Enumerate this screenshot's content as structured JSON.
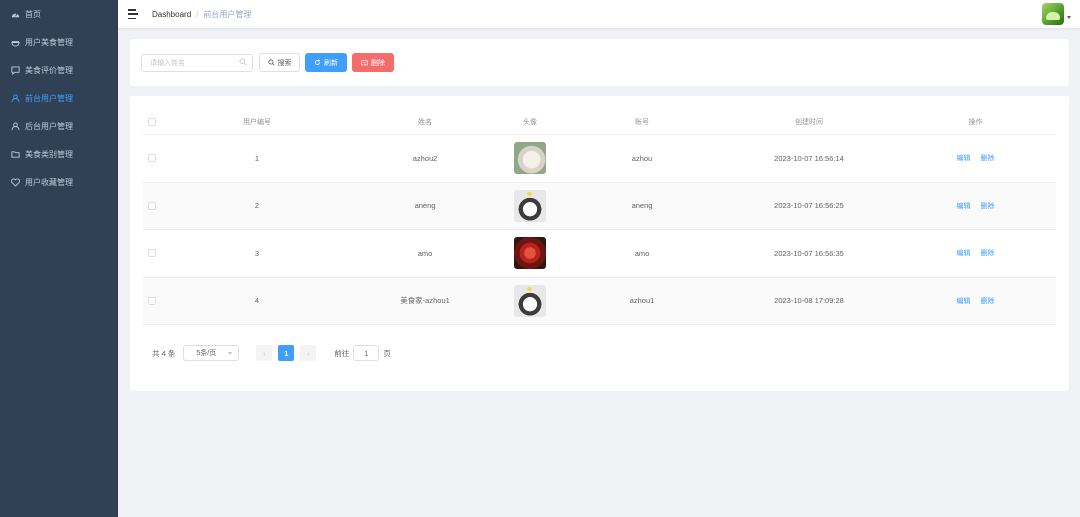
{
  "sidebar": {
    "items": [
      {
        "label": "首页",
        "icon": "dashboard-icon",
        "active": false
      },
      {
        "label": "用户美食管理",
        "icon": "food-icon",
        "active": false
      },
      {
        "label": "美食评价管理",
        "icon": "comment-icon",
        "active": false
      },
      {
        "label": "前台用户管理",
        "icon": "user-icon",
        "active": true
      },
      {
        "label": "后台用户管理",
        "icon": "user-icon",
        "active": false
      },
      {
        "label": "美食类别管理",
        "icon": "folder-icon",
        "active": false
      },
      {
        "label": "用户收藏管理",
        "icon": "heart-icon",
        "active": false
      }
    ]
  },
  "header": {
    "breadcrumb_home": "Dashboard",
    "breadcrumb_sep": "/",
    "breadcrumb_current": "前台用户管理"
  },
  "search": {
    "placeholder": "请输入姓名",
    "value": "",
    "search_label": "搜索",
    "refresh_label": "刷新",
    "delete_label": "删除"
  },
  "table": {
    "columns": [
      "用户编号",
      "姓名",
      "头像",
      "账号",
      "创建时间",
      "操作"
    ],
    "rows": [
      {
        "id": "1",
        "name": "azhou2",
        "avatar": "cat-photo",
        "account": "azhou",
        "created": "2023-10-07 16:56:14"
      },
      {
        "id": "2",
        "name": "aneng",
        "avatar": "husky-photo",
        "account": "aneng",
        "created": "2023-10-07 16:56:25"
      },
      {
        "id": "3",
        "name": "amo",
        "avatar": "flower-photo",
        "account": "amo",
        "created": "2023-10-07 16:56:35"
      },
      {
        "id": "4",
        "name": "美食家-azhou1",
        "avatar": "husky-photo",
        "account": "azhou1",
        "created": "2023-10-08 17:09:28"
      }
    ],
    "edit_label": "编辑",
    "delete_label": "删除"
  },
  "pagination": {
    "total": "共 4 条",
    "page_size": "5条/页",
    "prev": "‹",
    "current_page": "1",
    "next": "›",
    "goto_label": "前往",
    "goto_value": "1",
    "goto_suffix": "页"
  },
  "colors": {
    "sidebar_bg": "#304156",
    "sidebar_text": "#bfcbd9",
    "primary": "#409eff",
    "danger": "#f56c6c"
  }
}
